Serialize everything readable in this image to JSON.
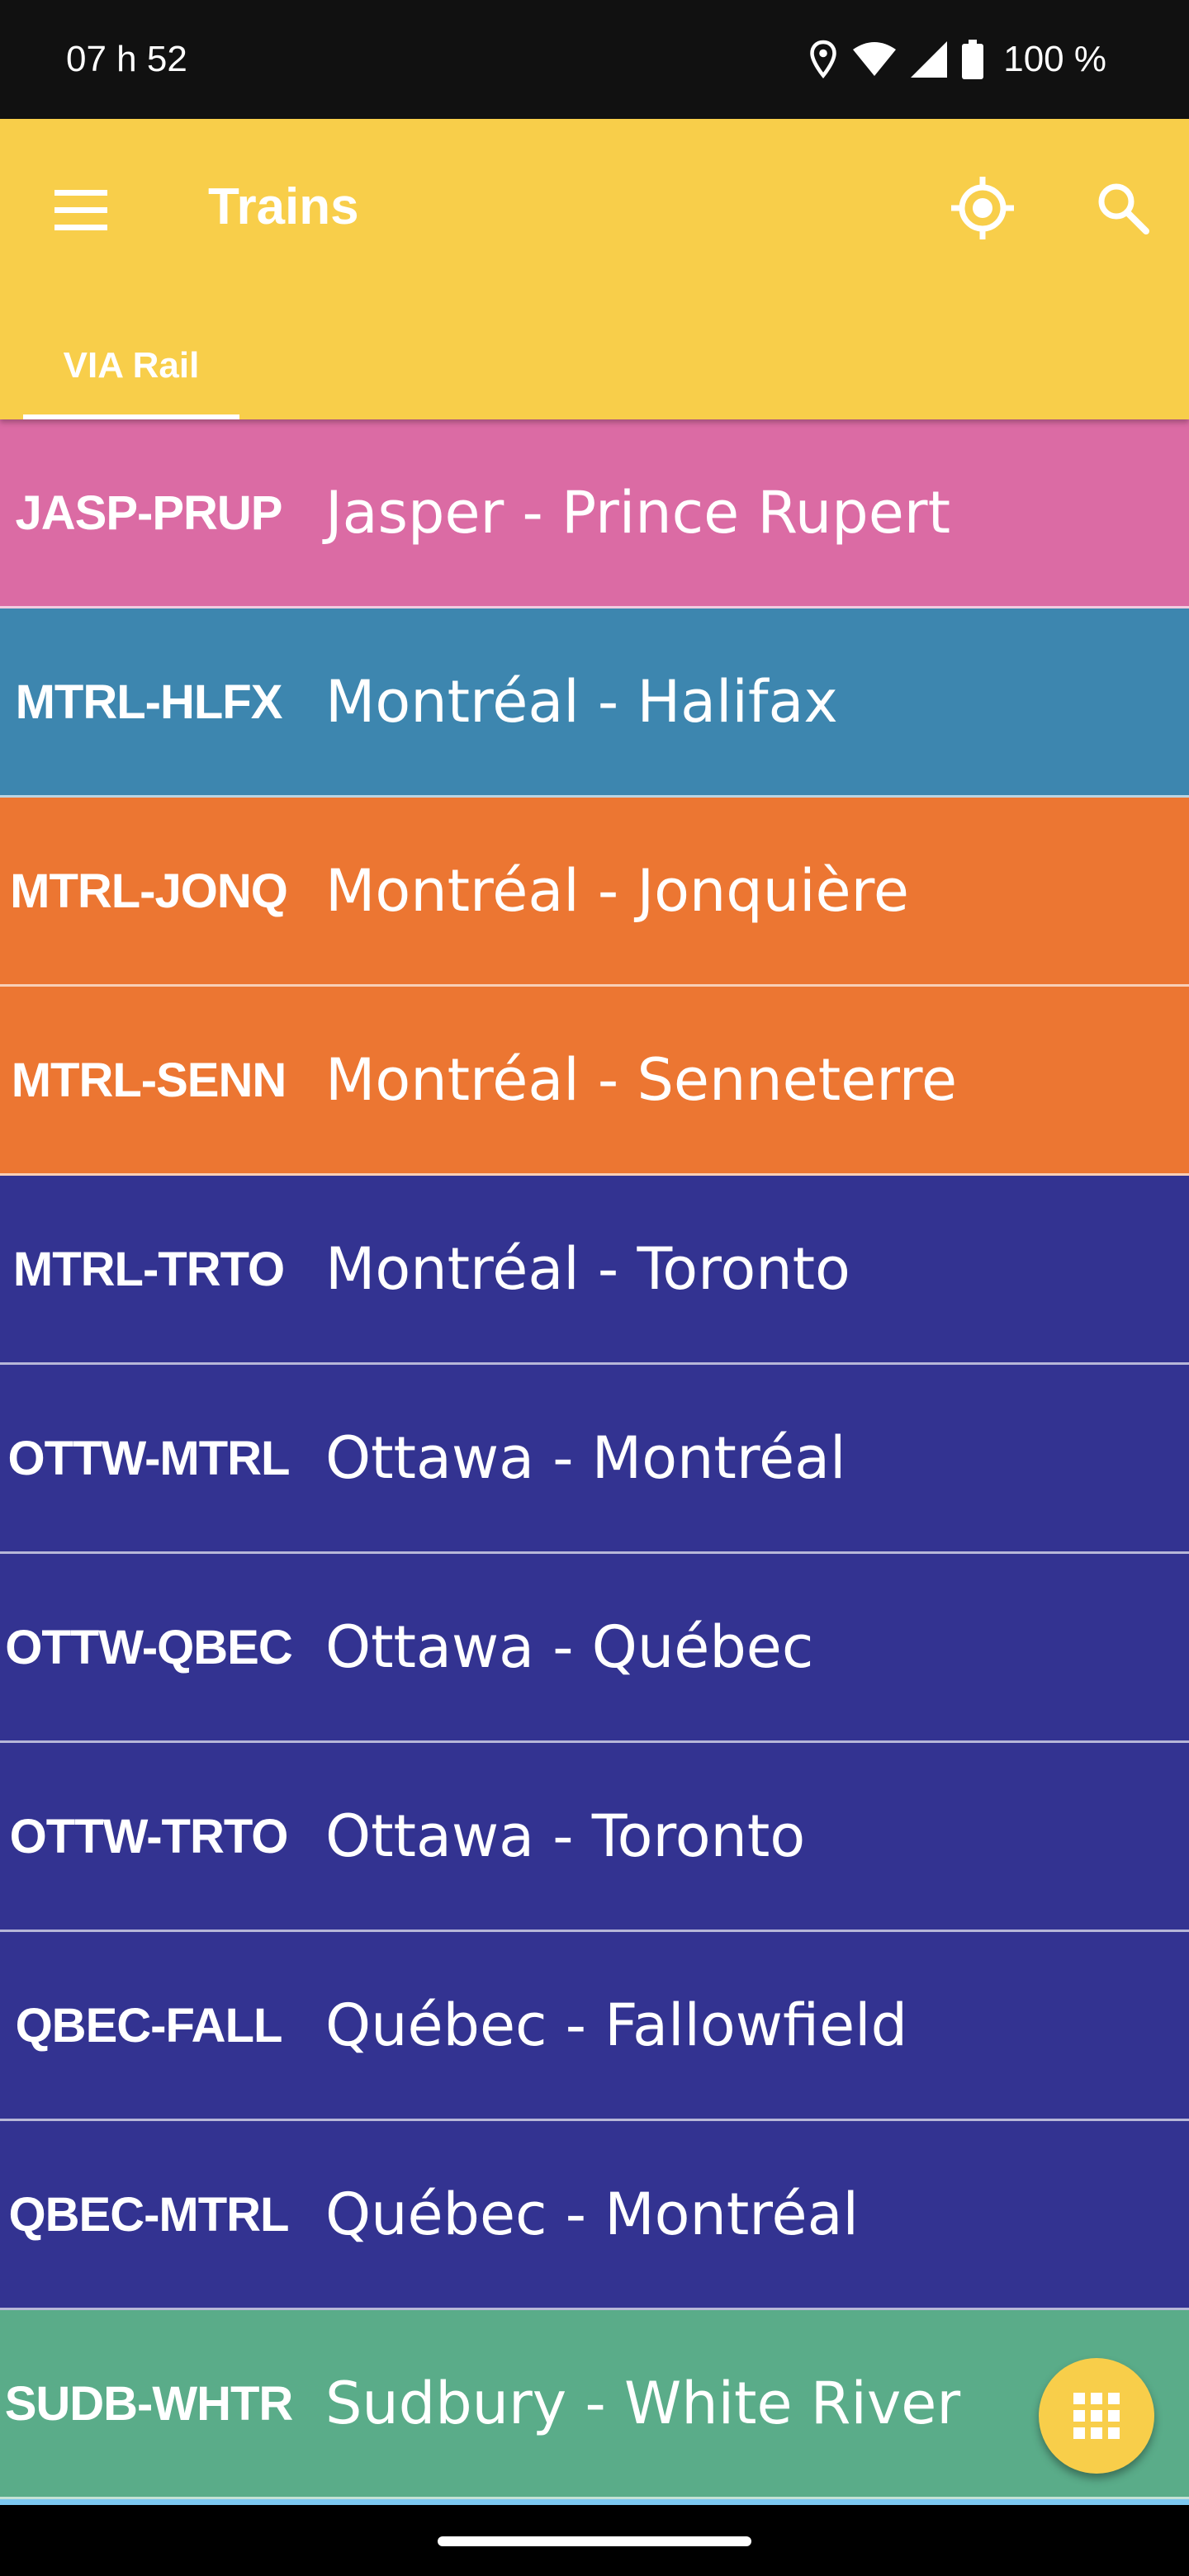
{
  "status_bar": {
    "time": "07 h 52",
    "battery": "100 %",
    "icons": [
      "location-icon",
      "wifi-icon",
      "cell-signal-icon",
      "battery-icon"
    ]
  },
  "app_bar": {
    "title": "Trains",
    "background": "#F8CE4A",
    "icons": [
      "menu-icon",
      "my-location-icon",
      "search-icon"
    ]
  },
  "tabs": [
    {
      "label": "VIA Rail",
      "selected": true
    }
  ],
  "routes": [
    {
      "code": "JASP-PRUP",
      "name": "Jasper - Prince Rupert",
      "color": "#DB6BA4"
    },
    {
      "code": "MTRL-HLFX",
      "name": "Montréal - Halifax",
      "color": "#3D86AF"
    },
    {
      "code": "MTRL-JONQ",
      "name": "Montréal - Jonquière",
      "color": "#EC7632"
    },
    {
      "code": "MTRL-SENN",
      "name": "Montréal - Senneterre",
      "color": "#EC7632"
    },
    {
      "code": "MTRL-TRTO",
      "name": "Montréal - Toronto",
      "color": "#333391"
    },
    {
      "code": "OTTW-MTRL",
      "name": "Ottawa - Montréal",
      "color": "#333391"
    },
    {
      "code": "OTTW-QBEC",
      "name": "Ottawa - Québec",
      "color": "#333391"
    },
    {
      "code": "OTTW-TRTO",
      "name": "Ottawa - Toronto",
      "color": "#333391"
    },
    {
      "code": "QBEC-FALL",
      "name": "Québec - Fallowfield",
      "color": "#333391"
    },
    {
      "code": "QBEC-MTRL",
      "name": "Québec - Montréal",
      "color": "#333391"
    },
    {
      "code": "SUDB-WHTR",
      "name": "Sudbury - White River",
      "color": "#5AAC89"
    }
  ],
  "fab": {
    "icon": "apps-grid-icon",
    "color": "#F8CE4A"
  }
}
